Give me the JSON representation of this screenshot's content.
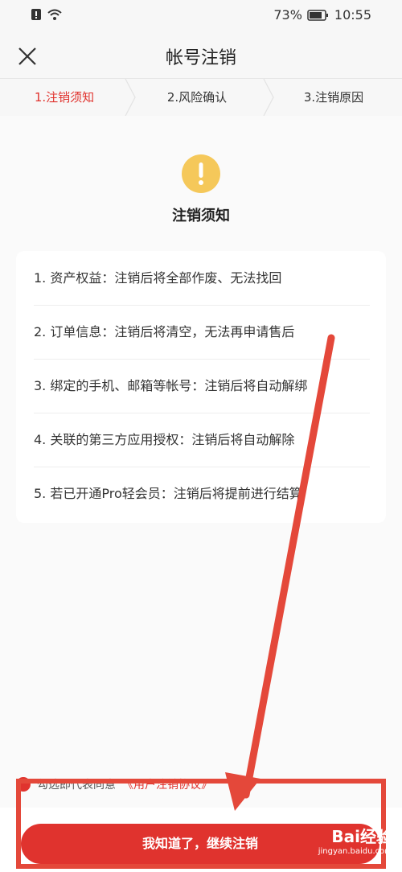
{
  "status": {
    "battery": "73%",
    "time": "10:55"
  },
  "header": {
    "title": "帐号注销"
  },
  "steps": [
    {
      "label": "1.注销须知"
    },
    {
      "label": "2.风险确认"
    },
    {
      "label": "3.注销原因"
    }
  ],
  "notice": {
    "title": "注销须知",
    "items": [
      "1. 资产权益：注销后将全部作废、无法找回",
      "2. 订单信息：注销后将清空，无法再申请售后",
      "3. 绑定的手机、邮箱等帐号：注销后将自动解绑",
      "4. 关联的第三方应用授权：注销后将自动解除",
      "5. 若已开通Pro轻会员：注销后将提前进行结算"
    ]
  },
  "agreement": {
    "text": "勾选即代表同意",
    "link": "《用户注销协议》"
  },
  "footer": {
    "continue_label": "我知道了，继续注销"
  },
  "watermark": {
    "logo": "Bai经验",
    "url": "jingyan.baidu.com"
  },
  "colors": {
    "accent": "#e0332e",
    "warning": "#f5c85a",
    "annotation": "#e4483a"
  }
}
